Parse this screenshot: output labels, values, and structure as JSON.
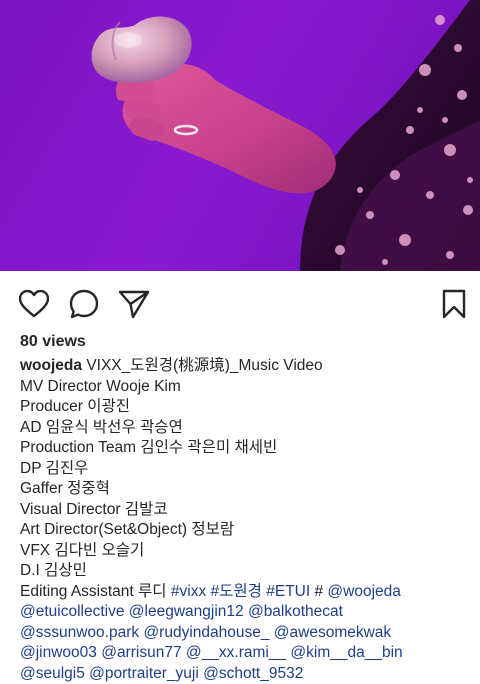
{
  "post": {
    "views": "80 views",
    "username": "woojeda",
    "title": " VIXX_도원경(桃源境)_Music Video"
  },
  "icons": {
    "like": "heart-icon",
    "comment": "comment-bubble-icon",
    "share": "paper-plane-icon",
    "save": "bookmark-icon"
  },
  "credits": [
    "MV Director Wooje Kim",
    "Producer 이광진",
    "AD 임윤식 박선우 곽승연",
    "Production Team 김인수 곽은미 채세빈",
    "DP 김진우",
    "Gaffer 정중혁",
    "Visual Director 김발코",
    "Art Director(Set&Object) 정보람",
    "VFX 김다빈 오슬기",
    "D.I 김상민"
  ],
  "editing_label": "Editing Assistant 루디 ",
  "tags": {
    "vixx": "#vixx",
    "dowongyeong": "#도원경",
    "etui": "#ETUI",
    "hash": " # ",
    "woojeda": "@woojeda",
    "etuicollective": "@etuicollective",
    "leegwangjin12": "@leegwangjin12",
    "balkothecat": "@balkothecat",
    "sssunwoo": "@sssunwoo.park",
    "rudyindahouse": "@rudyindahouse_",
    "awesomekwak": "@awesomekwak",
    "jinwoo03": "@jinwoo03",
    "arrisun77": "@arrisun77",
    "xxrami": "@__xx.rami__",
    "kimdabin": "@kim__da__bin",
    "seulgi5": "@seulgi5",
    "portraiter": "@portraiter_yuji",
    "schott": "@schott_9532"
  },
  "colors": {
    "background_purple": "#7a12c0",
    "link": "#1e3f87",
    "text": "#262626"
  }
}
